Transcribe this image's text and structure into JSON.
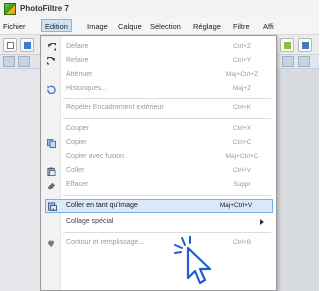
{
  "app": {
    "title": "PhotoFiltre 7"
  },
  "menubar": {
    "items": [
      "Fichier",
      "Edition",
      "Image",
      "Calque",
      "Sélection",
      "Réglage",
      "Filtre",
      "Affi"
    ],
    "active_index": 1
  },
  "menu": {
    "items": [
      {
        "label": "Défaire",
        "shortcut": "Ctrl+Z",
        "disabled": true,
        "icon": "undo-icon"
      },
      {
        "label": "Refaire",
        "shortcut": "Ctrl+Y",
        "disabled": true,
        "icon": "redo-icon"
      },
      {
        "label": "Atténuer",
        "shortcut": "Maj+Ctrl+Z",
        "disabled": true,
        "icon": ""
      },
      {
        "label": "Historiques...",
        "shortcut": "Maj+Z",
        "disabled": true,
        "icon": "history-icon"
      },
      {
        "label": "Répéter Encadrement extérieur",
        "shortcut": "Ctrl+K",
        "disabled": true,
        "icon": ""
      },
      {
        "label": "Couper",
        "shortcut": "Ctrl+X",
        "disabled": true,
        "icon": ""
      },
      {
        "label": "Copier",
        "shortcut": "Ctrl+C",
        "disabled": true,
        "icon": "copy-icon"
      },
      {
        "label": "Copier avec fusion",
        "shortcut": "Maj+Ctrl+C",
        "disabled": true,
        "icon": ""
      },
      {
        "label": "Coller",
        "shortcut": "Ctrl+V",
        "disabled": true,
        "icon": "paste-icon"
      },
      {
        "label": "Effacer",
        "shortcut": "Suppr",
        "disabled": true,
        "icon": "eraser-icon"
      },
      {
        "label": "Coller en tant qu'image",
        "shortcut": "Maj+Ctrl+V",
        "disabled": false,
        "highlight": true,
        "icon": "paste-as-image-icon"
      },
      {
        "label": "Collage spécial",
        "shortcut": "",
        "disabled": false,
        "submenu": true,
        "icon": ""
      },
      {
        "label": "Contour et remplissage...",
        "shortcut": "Ctrl+B",
        "disabled": true,
        "icon": "outline-fill-icon"
      }
    ]
  },
  "colors": {
    "highlight_bg": "#d9e9f9",
    "highlight_border": "#7eb0de",
    "cursor": "#1f5fcf",
    "app_logo": "#7fc234"
  }
}
